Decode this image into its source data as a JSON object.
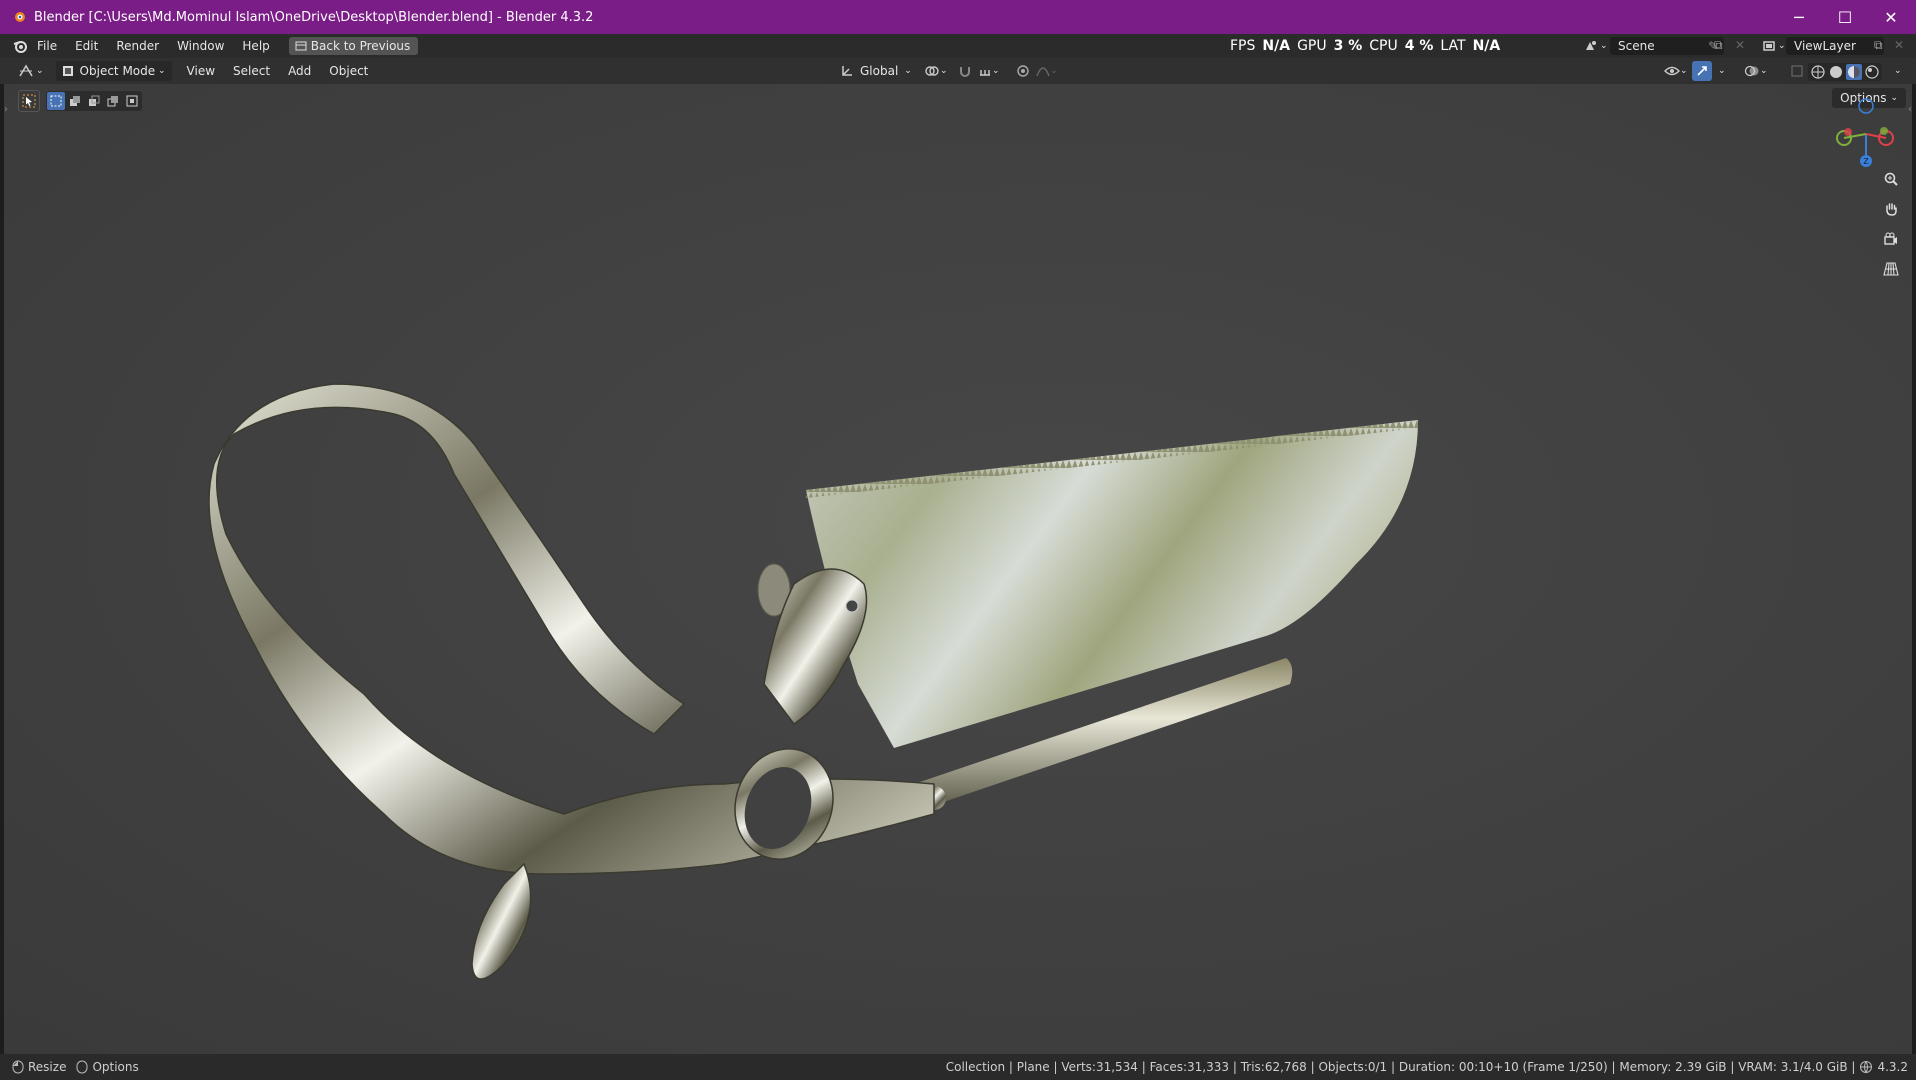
{
  "window": {
    "title": "Blender [C:\\Users\\Md.Mominul Islam\\OneDrive\\Desktop\\Blender.blend] - Blender 4.3.2",
    "minimize": "─",
    "maximize": "☐",
    "close": "✕"
  },
  "menu": {
    "items": [
      "File",
      "Edit",
      "Render",
      "Window",
      "Help"
    ],
    "back_button": "Back to Previous"
  },
  "perf": {
    "fps_label": "FPS",
    "fps_value": "N/A",
    "gpu_label": "GPU",
    "gpu_value": "3 %",
    "cpu_label": "CPU",
    "cpu_value": "4 %",
    "lat_label": "LAT",
    "lat_value": "N/A"
  },
  "scene": {
    "name": "Scene"
  },
  "view_layer": {
    "name": "ViewLayer"
  },
  "header": {
    "mode": "Object Mode",
    "menus": [
      "View",
      "Select",
      "Add",
      "Object"
    ],
    "orientation": "Global",
    "options": "Options"
  },
  "gizmo": {
    "z_label": "Z"
  },
  "statusbar": {
    "resize": "Resize",
    "options": "Options",
    "stats": "Collection | Plane | Verts:31,534 | Faces:31,333 | Tris:62,768 | Objects:0/1 | Duration: 00:10+10 (Frame 1/250) | Memory: 2.39 GiB | VRAM: 3.1/4.0 GiB |",
    "version": "4.3.2"
  },
  "colors": {
    "titlebar": "#7a1d86",
    "viewport": "#404040",
    "accent": "#4772b3",
    "axis_x": "#e0404a",
    "axis_y": "#7fb13c",
    "axis_z": "#3a7fd8"
  }
}
